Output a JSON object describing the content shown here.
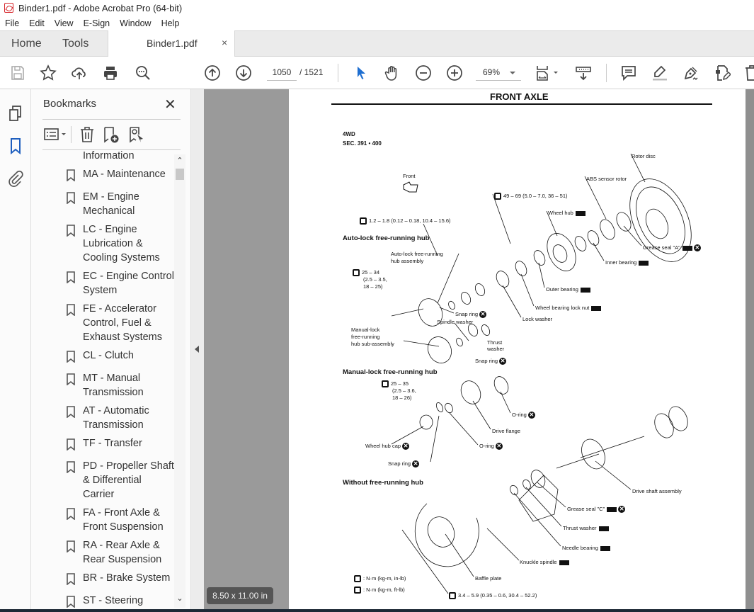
{
  "window": {
    "title": "Binder1.pdf - Adobe Acrobat Pro (64-bit)"
  },
  "menu": [
    "File",
    "Edit",
    "View",
    "E-Sign",
    "Window",
    "Help"
  ],
  "tabs": {
    "home": "Home",
    "tools": "Tools",
    "document": "Binder1.pdf",
    "close_glyph": "×"
  },
  "toolbar": {
    "current_page": "1050",
    "total_pages": "/ 1521",
    "zoom": "69%",
    "icons": [
      "save-icon",
      "bookmark-star-icon",
      "upload-cloud-icon",
      "print-icon",
      "find-icon",
      "page-up-icon",
      "page-down-icon",
      "select-cursor-icon",
      "hand-icon",
      "zoom-out-icon",
      "zoom-in-icon",
      "fit-page-icon",
      "scroll-mode-icon",
      "comment-icon",
      "highlight-icon",
      "sign-icon",
      "edit-pdf-icon",
      "delete-icon"
    ]
  },
  "left_rail": {
    "icons": [
      "page-thumbnails-icon",
      "bookmarks-icon",
      "attachments-icon"
    ],
    "active": "bookmarks-icon"
  },
  "bookmarks": {
    "title": "Bookmarks",
    "close_glyph": "✕",
    "items": [
      {
        "label": "Information",
        "partial": true
      },
      {
        "label": "MA - Maintenance"
      },
      {
        "label": "EM - Engine Mechanical"
      },
      {
        "label": "LC - Engine Lubrication & Cooling Systems"
      },
      {
        "label": "EC - Engine Control System"
      },
      {
        "label": "FE - Accelerator Control, Fuel & Exhaust Systems"
      },
      {
        "label": "CL - Clutch"
      },
      {
        "label": "MT - Manual Transmission"
      },
      {
        "label": "AT - Automatic Transmission"
      },
      {
        "label": "TF - Transfer"
      },
      {
        "label": "PD - Propeller Shaft & Differential Carrier"
      },
      {
        "label": "FA - Front Axle & Front Suspension"
      },
      {
        "label": "RA - Rear Axle & Rear Suspension"
      },
      {
        "label": "BR - Brake System"
      },
      {
        "label": "ST - Steering"
      }
    ]
  },
  "page_size": "8.50 x 11.00 in",
  "document": {
    "header": "FRONT AXLE",
    "model": "4WD",
    "section": "SEC. 391 • 400",
    "front_label": "Front",
    "sections": {
      "auto": "Auto-lock free-running hub",
      "manual": "Manual-lock free-running hub",
      "without": "Without free-running hub"
    },
    "torque": {
      "t1": "1.2 – 1.8 (0.12 – 0.18, 10.4 – 15.6)",
      "t2": "49 – 69 (5.0 – 7.0, 36 – 51)",
      "t3_l1": "25 – 34",
      "t3_l2": "(2.5 – 3.5,",
      "t3_l3": "18 – 25)",
      "t4_l1": "25 – 35",
      "t4_l2": "(2.5 – 3.6,",
      "t4_l3": "18 – 26)",
      "t5": "3.4 – 5.9 (0.35 – 0.6, 30.4 – 52.2)"
    },
    "parts": {
      "rotor_disc": "Rotor disc",
      "abs_rotor": "ABS sensor rotor",
      "wheel_hub": "Wheel hub",
      "grease_seal_a": "Grease seal \"A\"",
      "inner_bearing": "Inner bearing",
      "outer_bearing": "Outer bearing",
      "lock_nut": "Wheel bearing lock nut",
      "lock_washer": "Lock washer",
      "auto_hub_assy_l1": "Auto-lock free-running",
      "auto_hub_assy_l2": "hub assembly",
      "snap_ring1": "Snap ring",
      "spindle_washer": "Spindle washer",
      "thrust_washer_l1": "Thrust",
      "thrust_washer_l2": "washer",
      "manual_sub_l1": "Manual-lock",
      "manual_sub_l2": "free-running",
      "manual_sub_l3": "hub sub-assembly",
      "snap_ring2": "Snap ring",
      "o_ring1": "O-ring",
      "drive_flange": "Drive flange",
      "o_ring2": "O-ring",
      "wheel_hub_cap": "Wheel hub cap",
      "snap_ring3": "Snap ring",
      "drive_shaft": "Drive shaft assembly",
      "grease_seal_c": "Grease seal \"C\"",
      "thrust_washer2": "Thrust washer",
      "needle_bearing": "Needle bearing",
      "knuckle_spindle": "Knuckle spindle",
      "baffle_plate": "Baffle plate"
    },
    "legend": {
      "nm_in": ": N·m (kg-m, in-lb)",
      "nm_ft": ": N·m (kg-m, ft-lb)"
    }
  }
}
